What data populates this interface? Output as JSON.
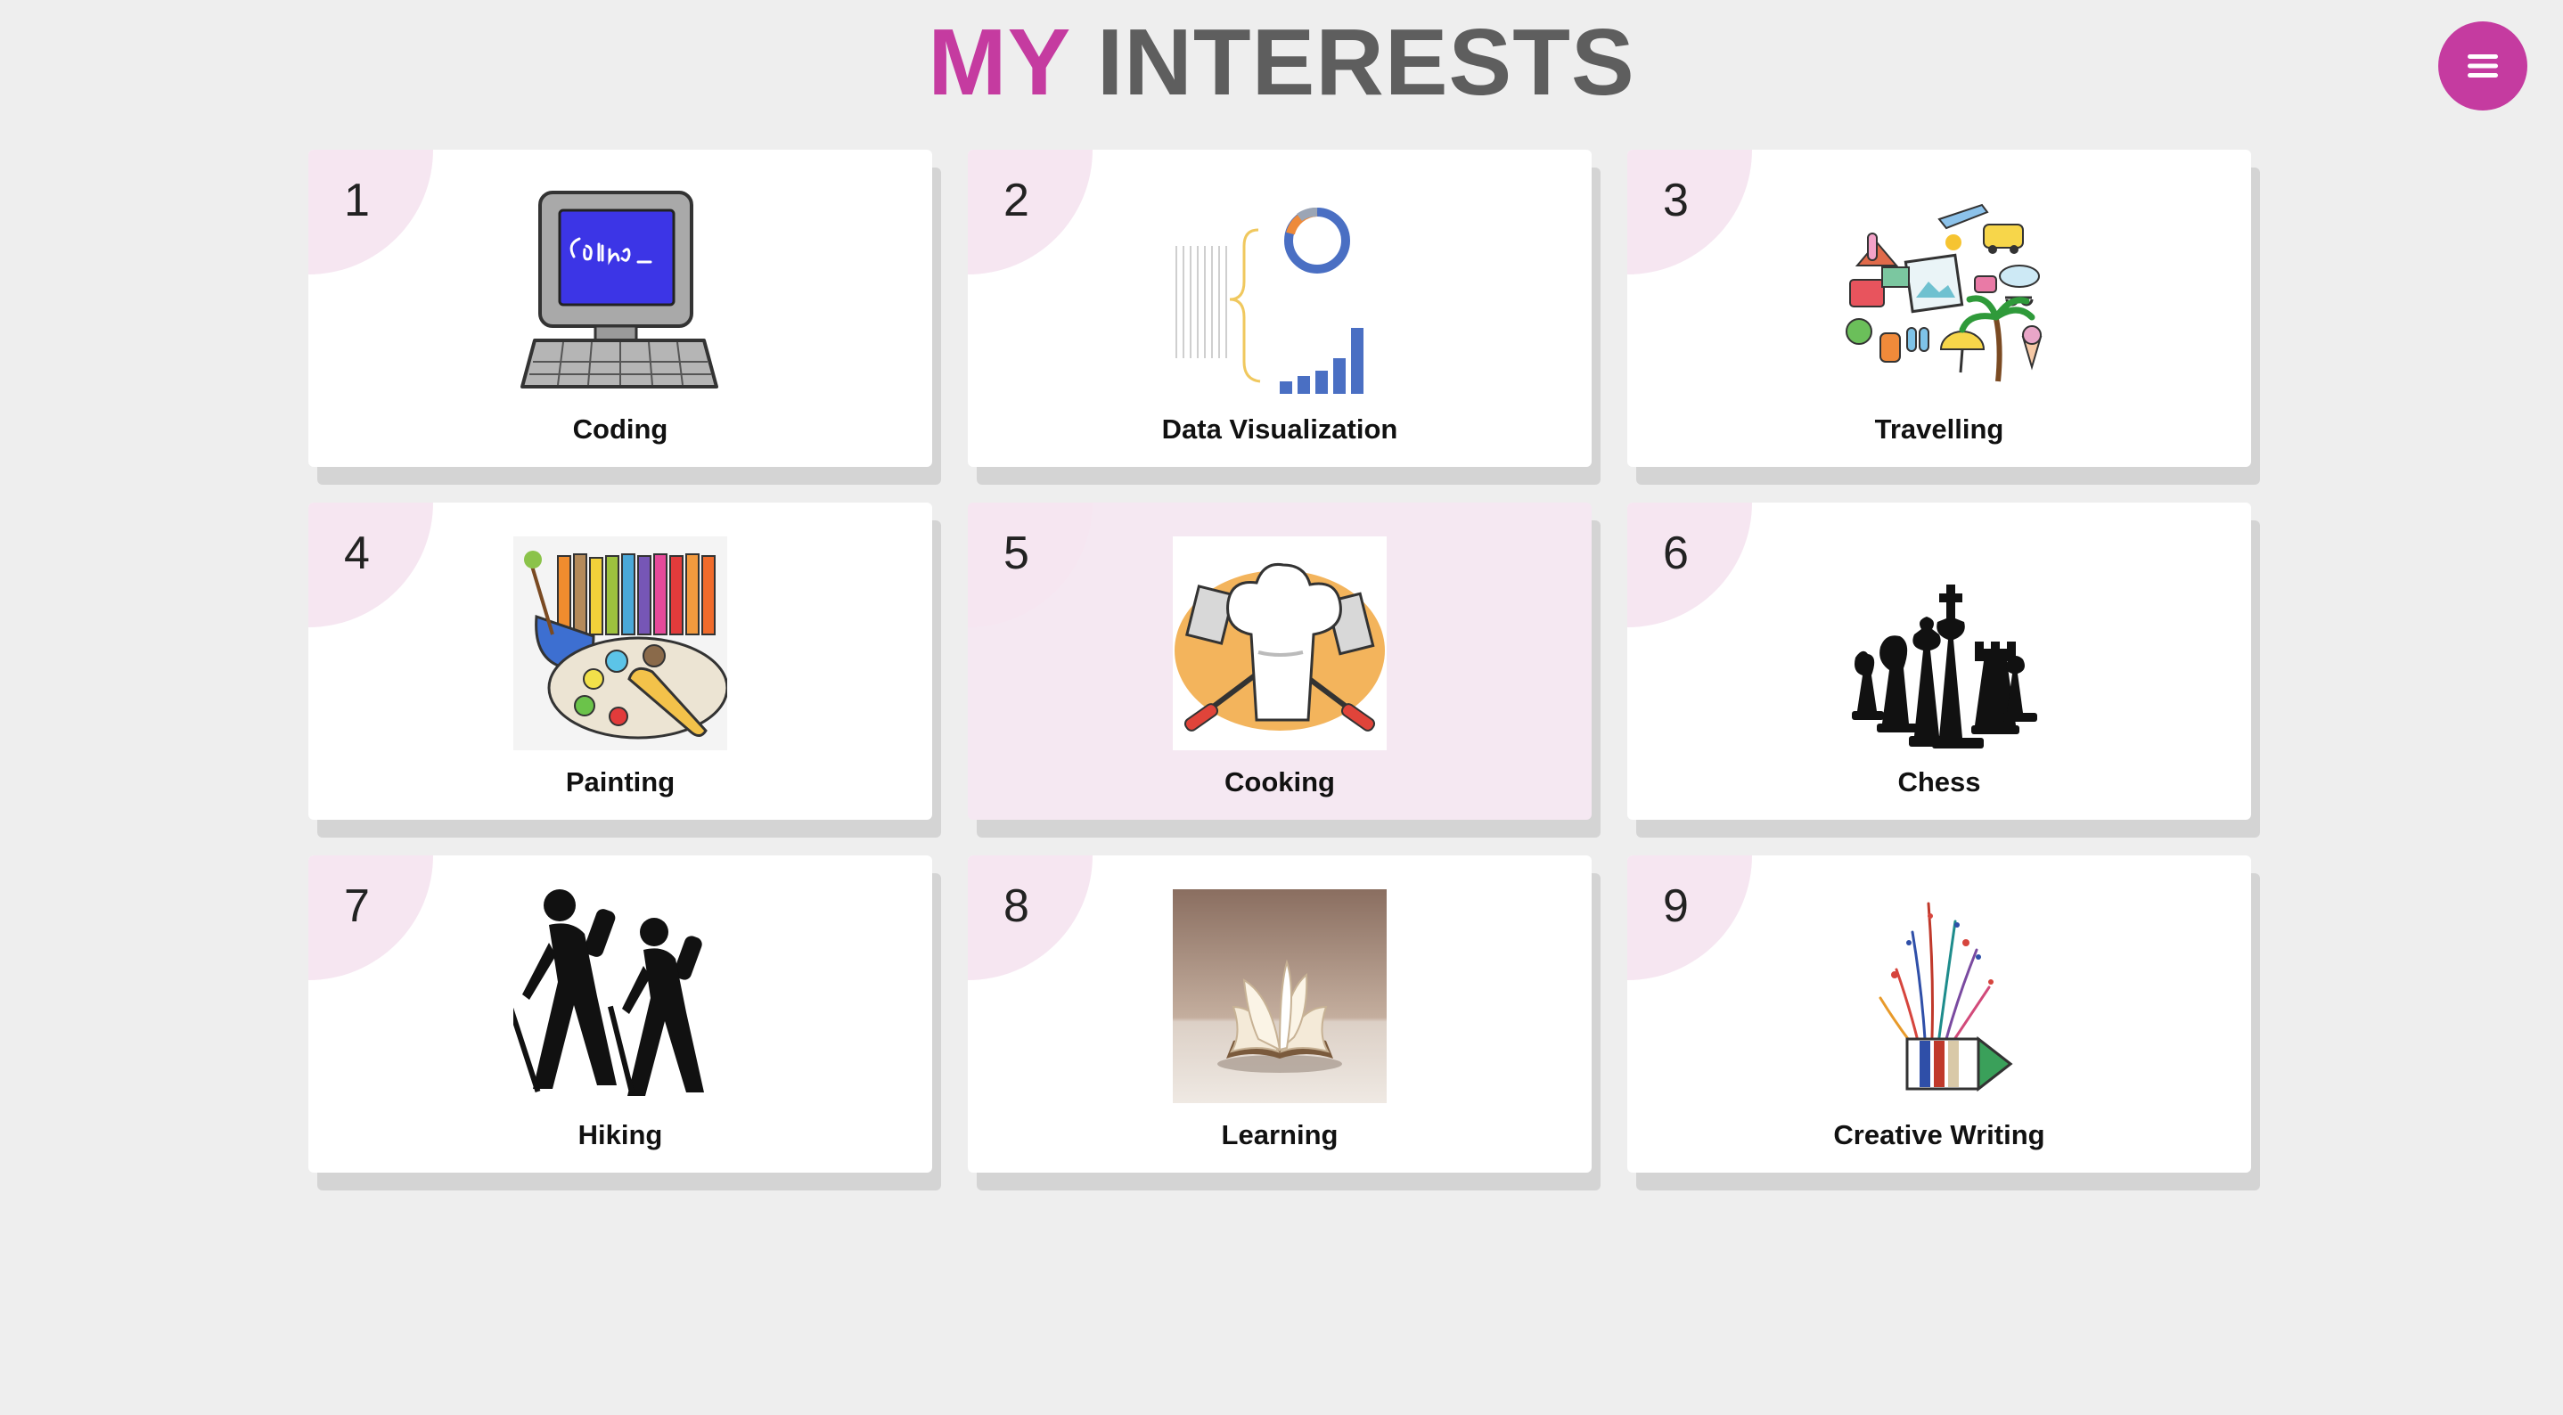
{
  "header": {
    "title_accent": "MY",
    "title_rest": "INTERESTS",
    "accent_color": "#c53ba0",
    "title_color": "#5e5e5e",
    "menu_icon": "hamburger-menu-icon"
  },
  "cards": [
    {
      "number": "1",
      "label": "Coding",
      "icon": "computer-coding-icon"
    },
    {
      "number": "2",
      "label": "Data Visualization",
      "icon": "data-visualization-icon"
    },
    {
      "number": "3",
      "label": "Travelling",
      "icon": "travel-collage-icon"
    },
    {
      "number": "4",
      "label": "Painting",
      "icon": "paint-palette-icon"
    },
    {
      "number": "5",
      "label": "Cooking",
      "icon": "chef-hat-icon",
      "highlighted": true
    },
    {
      "number": "6",
      "label": "Chess",
      "icon": "chess-pieces-icon"
    },
    {
      "number": "7",
      "label": "Hiking",
      "icon": "hikers-icon"
    },
    {
      "number": "8",
      "label": "Learning",
      "icon": "open-book-icon"
    },
    {
      "number": "9",
      "label": "Creative Writing",
      "icon": "pen-splash-icon"
    }
  ],
  "colors": {
    "page_background": "#eeeeee",
    "card_background": "#ffffff",
    "card_highlight": "#f5e8f2",
    "corner_tint": "#f6e6f1",
    "card_shadow": "#d4d4d4"
  }
}
